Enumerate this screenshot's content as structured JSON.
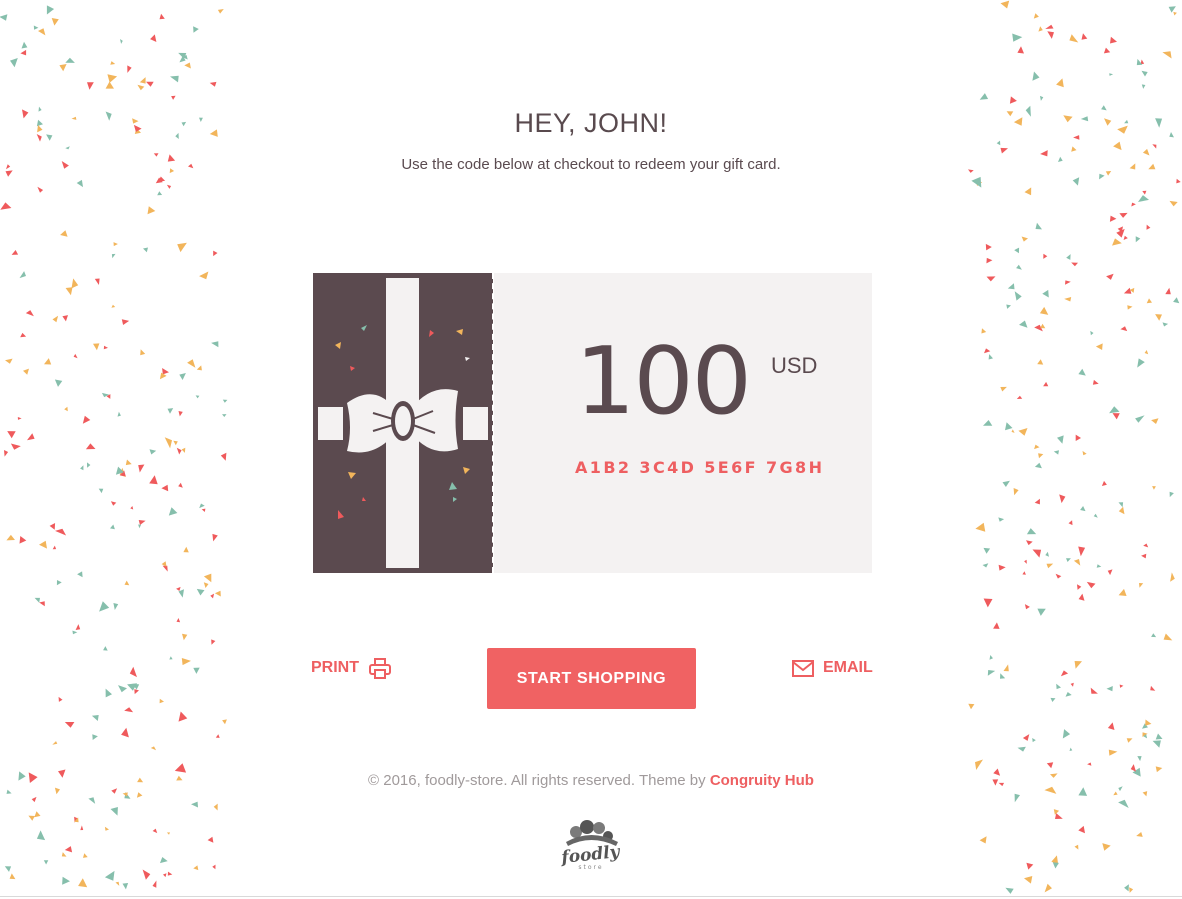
{
  "greeting": "HEY, JOHN!",
  "subtitle": "Use the code below at checkout to redeem your gift card.",
  "gift_card": {
    "amount": "100",
    "currency": "USD",
    "code": "A1B2 3C4D 5E6F 7G8H"
  },
  "actions": {
    "print_label": "PRINT",
    "shop_label": "START SHOPPING",
    "email_label": "EMAIL"
  },
  "footer": {
    "text": "© 2016, foodly-store. All rights reserved. Theme by",
    "link_label": "Congruity Hub"
  },
  "logo": {
    "text": "foodly",
    "subtext": "store"
  },
  "icons": [
    "gift-bow-icon",
    "printer-icon",
    "mail-icon",
    "foodly-logo"
  ],
  "colors": {
    "accent": "#ee5f61",
    "card_dark": "#5b4a4f",
    "card_light": "#f4f2f2",
    "text": "#5a4a4f",
    "confetti_red": "#ef5a5c",
    "confetti_yellow": "#f2b55b",
    "confetti_teal": "#86bfac"
  }
}
